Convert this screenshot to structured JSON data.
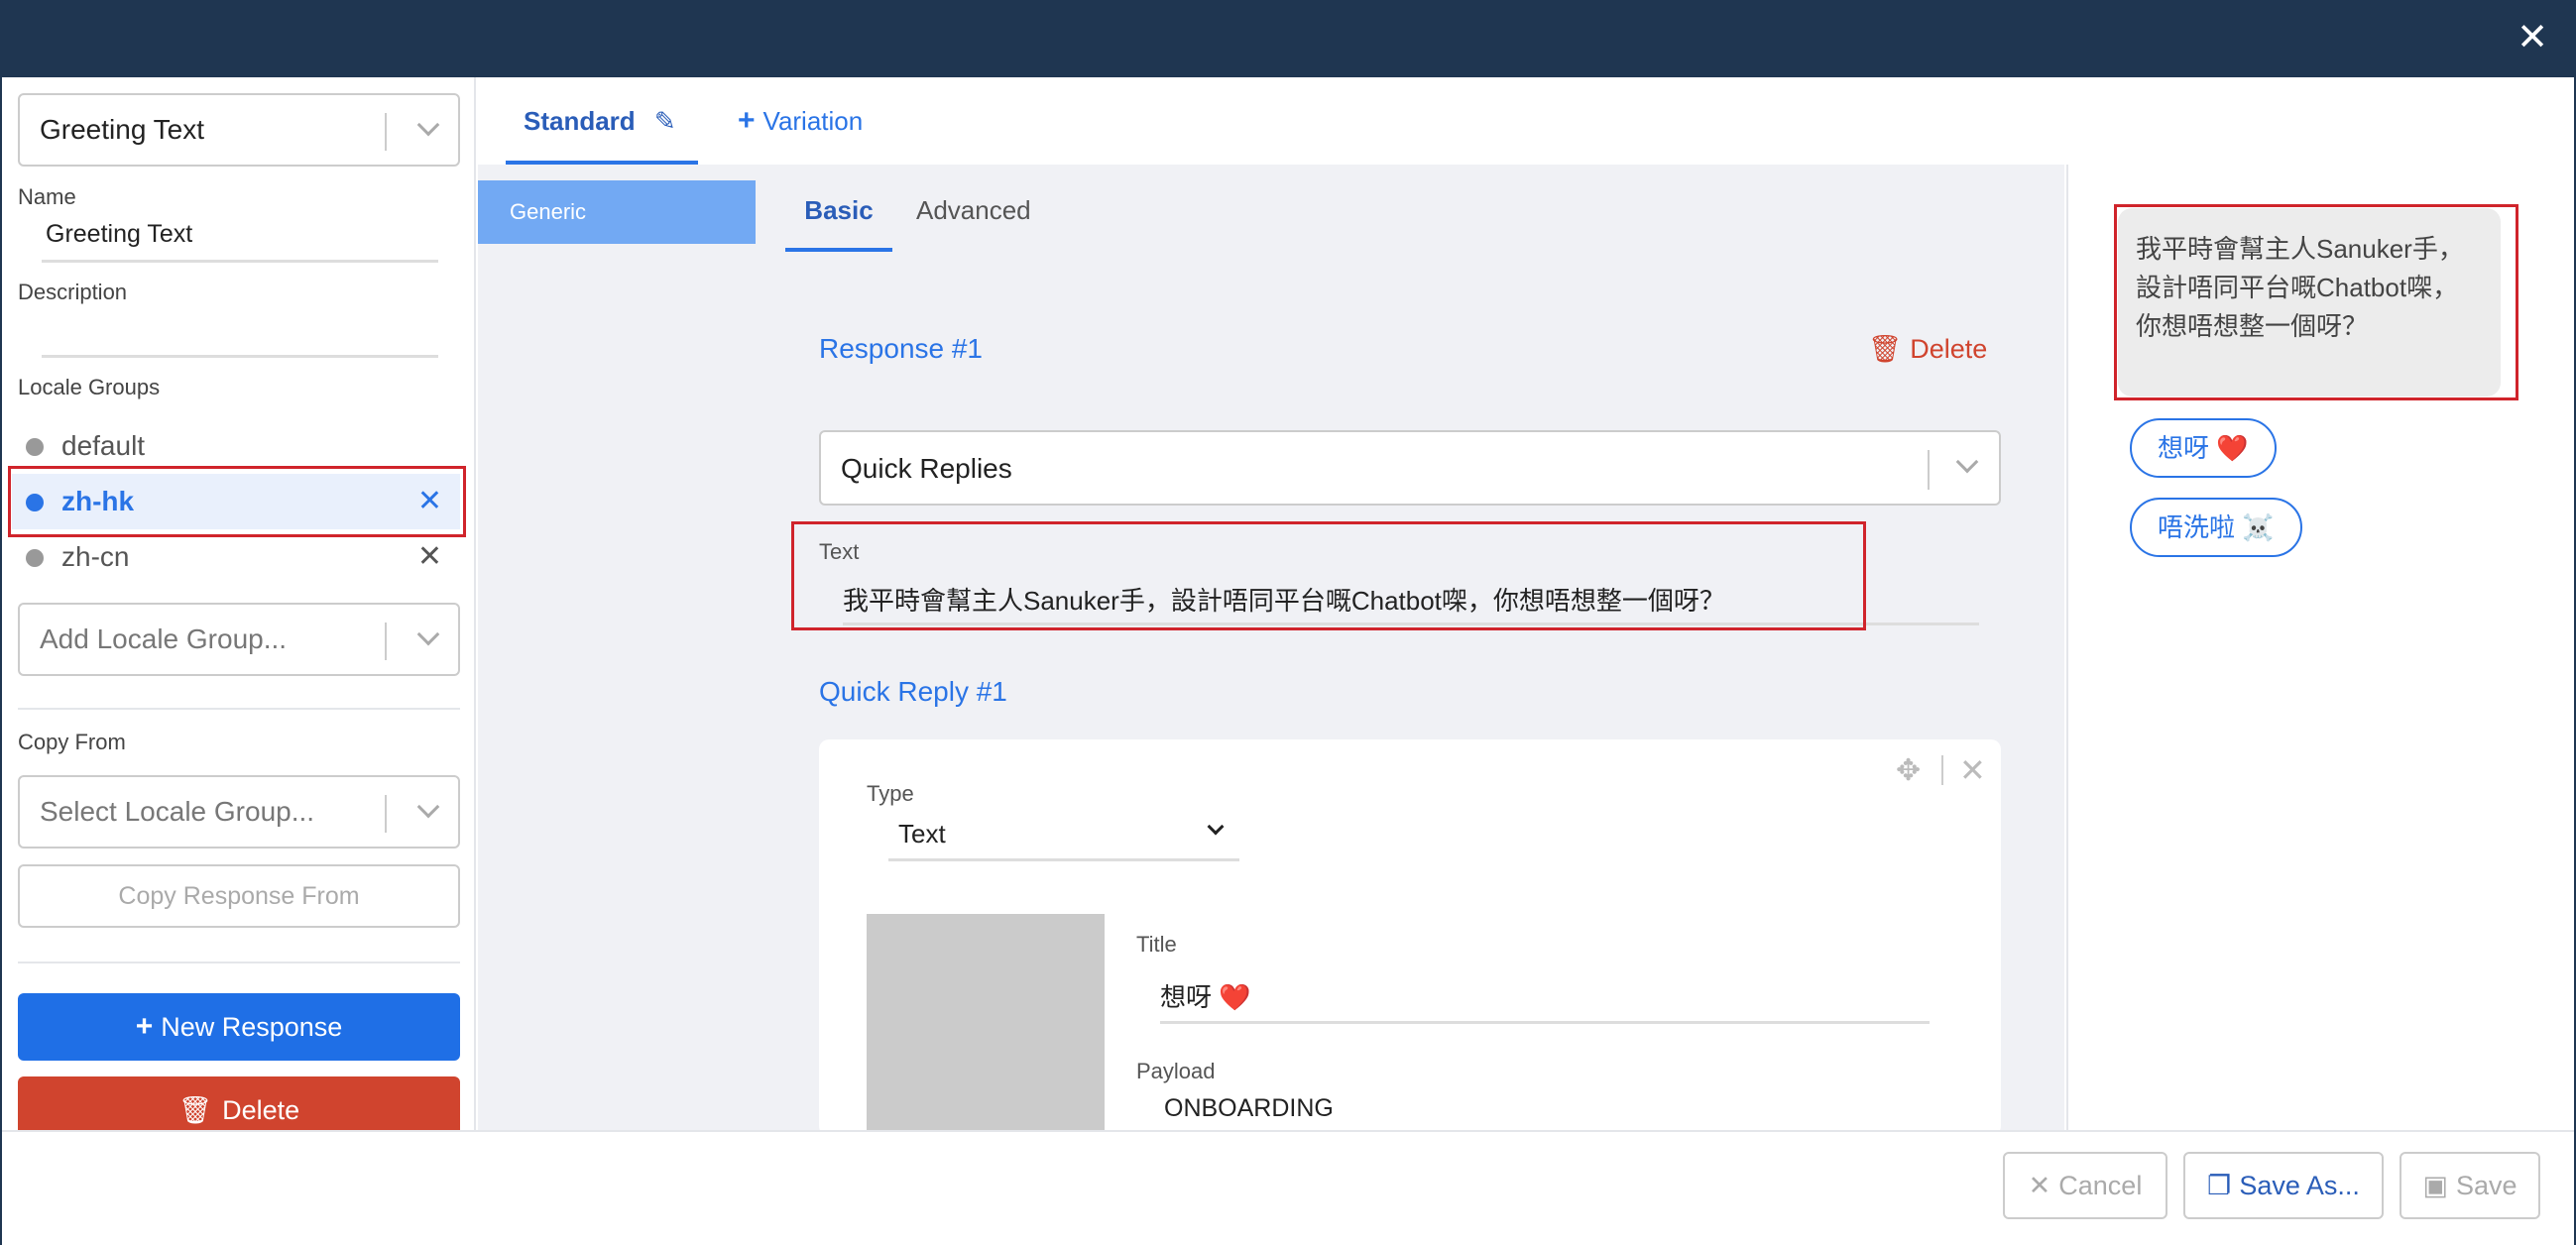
{
  "window": {
    "close_label": "✕"
  },
  "sidebar": {
    "response_select": "Greeting Text",
    "name_label": "Name",
    "name_value": "Greeting Text",
    "description_label": "Description",
    "description_value": "",
    "locale_groups_label": "Locale Groups",
    "locales": [
      {
        "label": "default",
        "active": false,
        "removable": false
      },
      {
        "label": "zh-hk",
        "active": true,
        "removable": true
      },
      {
        "label": "zh-cn",
        "active": false,
        "removable": true
      }
    ],
    "add_locale_placeholder": "Add Locale Group...",
    "copy_from_label": "Copy From",
    "select_locale_placeholder": "Select Locale Group...",
    "copy_response_label": "Copy Response From",
    "new_response_label": "New Response",
    "delete_label": "Delete"
  },
  "tabs": {
    "standard": "Standard",
    "variation": "Variation",
    "generic": "Generic",
    "basic": "Basic",
    "advanced": "Advanced"
  },
  "response": {
    "title": "Response #1",
    "delete_label": "Delete",
    "type_select": "Quick Replies",
    "text_label": "Text",
    "text_value": "我平時會幫主人Sanuker手，設計唔同平台嘅Chatbot㗎，你想唔想整一個呀？"
  },
  "quick_reply": {
    "title": "Quick Reply #1",
    "type_label": "Type",
    "type_value": "Text",
    "title_label": "Title",
    "title_value": "想呀 ❤️",
    "payload_label": "Payload",
    "payload_value": "ONBOARDING"
  },
  "preview": {
    "bubble_text": "我平時會幫主人Sanuker手，設計唔同平台嘅Chatbot㗎，你想唔想整一個呀？",
    "chips": [
      "想呀 ❤️",
      "唔洗啦 ☠️"
    ]
  },
  "footer": {
    "cancel": "Cancel",
    "save_as": "Save As...",
    "save": "Save"
  },
  "colors": {
    "titlebar": "#1f3651",
    "accent": "#2a74e6",
    "danger": "#d0442e",
    "highlight": "#d0242b"
  }
}
